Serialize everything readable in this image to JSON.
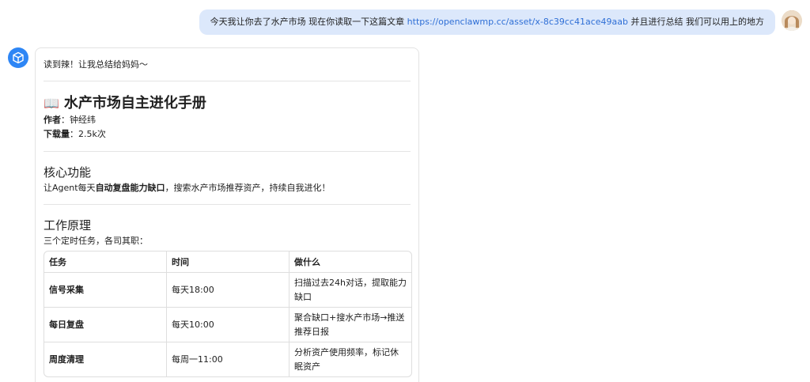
{
  "user_message": {
    "text": "今天我让你去了水产市场 现在你读取一下这篇文章 ",
    "link": "https://openclawmp.cc/asset/x-8c39cc41ace49aab",
    "suffix": " 并且进行总结 我们可以用上的地方"
  },
  "bot_message": {
    "intro": "读到辣！让我总结给妈妈～",
    "title_icon": "📖",
    "title": "水产市场自主进化手册",
    "author_label": "作者",
    "author": "钟经纬",
    "downloads_label": "下载量",
    "downloads": "2.5k次",
    "section1_title": "核心功能",
    "section1_pre": "让Agent每天",
    "section1_bold": "自动复盘能力缺口",
    "section1_post": "，搜索水产市场推荐资产，持续自我进化！",
    "section2_title": "工作原理",
    "section2_desc": "三个定时任务，各司其职：",
    "table": {
      "headers": [
        "任务",
        "时间",
        "做什么"
      ],
      "rows": [
        [
          "信号采集",
          "每天18:00",
          "扫描过去24h对话，提取能力缺口"
        ],
        [
          "每日复盘",
          "每天10:00",
          "聚合缺口+搜水产市场→推送推荐日报"
        ],
        [
          "周度清理",
          "每周一11:00",
          "分析资产使用频率，标记休眠资产"
        ]
      ]
    }
  },
  "colors": {
    "user_bubble": "#dce8fb",
    "link": "#2f6fd6",
    "bot_avatar": "#2e86f5"
  },
  "icons": {
    "bot_avatar": "cube-icon",
    "user_avatar": "user-photo-avatar",
    "title": "open-book-icon"
  }
}
